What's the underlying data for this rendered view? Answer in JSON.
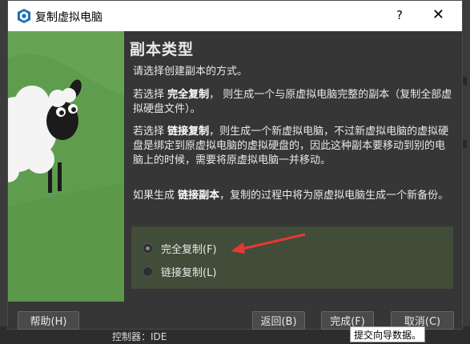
{
  "window": {
    "title": "复制虚拟电脑",
    "help_label": "?",
    "close_label": "✕"
  },
  "content": {
    "heading": "副本类型",
    "intro": "请选择创建副本的方式。",
    "full_prefix": "若选择 ",
    "full_bold": "完全复制",
    "full_text": "， 则生成一个与原虚拟电脑完整的副本（复制全部虚拟硬盘文件）。",
    "linked_prefix": "若选择 ",
    "linked_bold": "链接复制",
    "linked_text": "，则生成一个新虚拟电脑，不过新虚拟电脑的虚拟硬盘是绑定到原虚拟电脑的虚拟硬盘的，因此这种副本要移动到别的电脑上的时候，需要将原虚拟电脑一并移动。",
    "snapshot_prefix": "如果生成 ",
    "snapshot_bold": "链接副本",
    "snapshot_text": "，复制的过程中将为原虚拟电脑生成一个新备份。"
  },
  "options": {
    "full_clone": "完全复制(F)",
    "linked_clone": "链接复制(L)",
    "selected": "full_clone"
  },
  "buttons": {
    "help": "帮助(H)",
    "back": "返回(B)",
    "finish": "完成(F)",
    "cancel": "取消(C)"
  },
  "tooltip": "提交向导数据。",
  "background": {
    "bottom_text": "控制器：IDE"
  },
  "colors": {
    "dialog_bg": "#363636",
    "image_green": "#5f9d4e",
    "arrow_red": "#e53935"
  }
}
